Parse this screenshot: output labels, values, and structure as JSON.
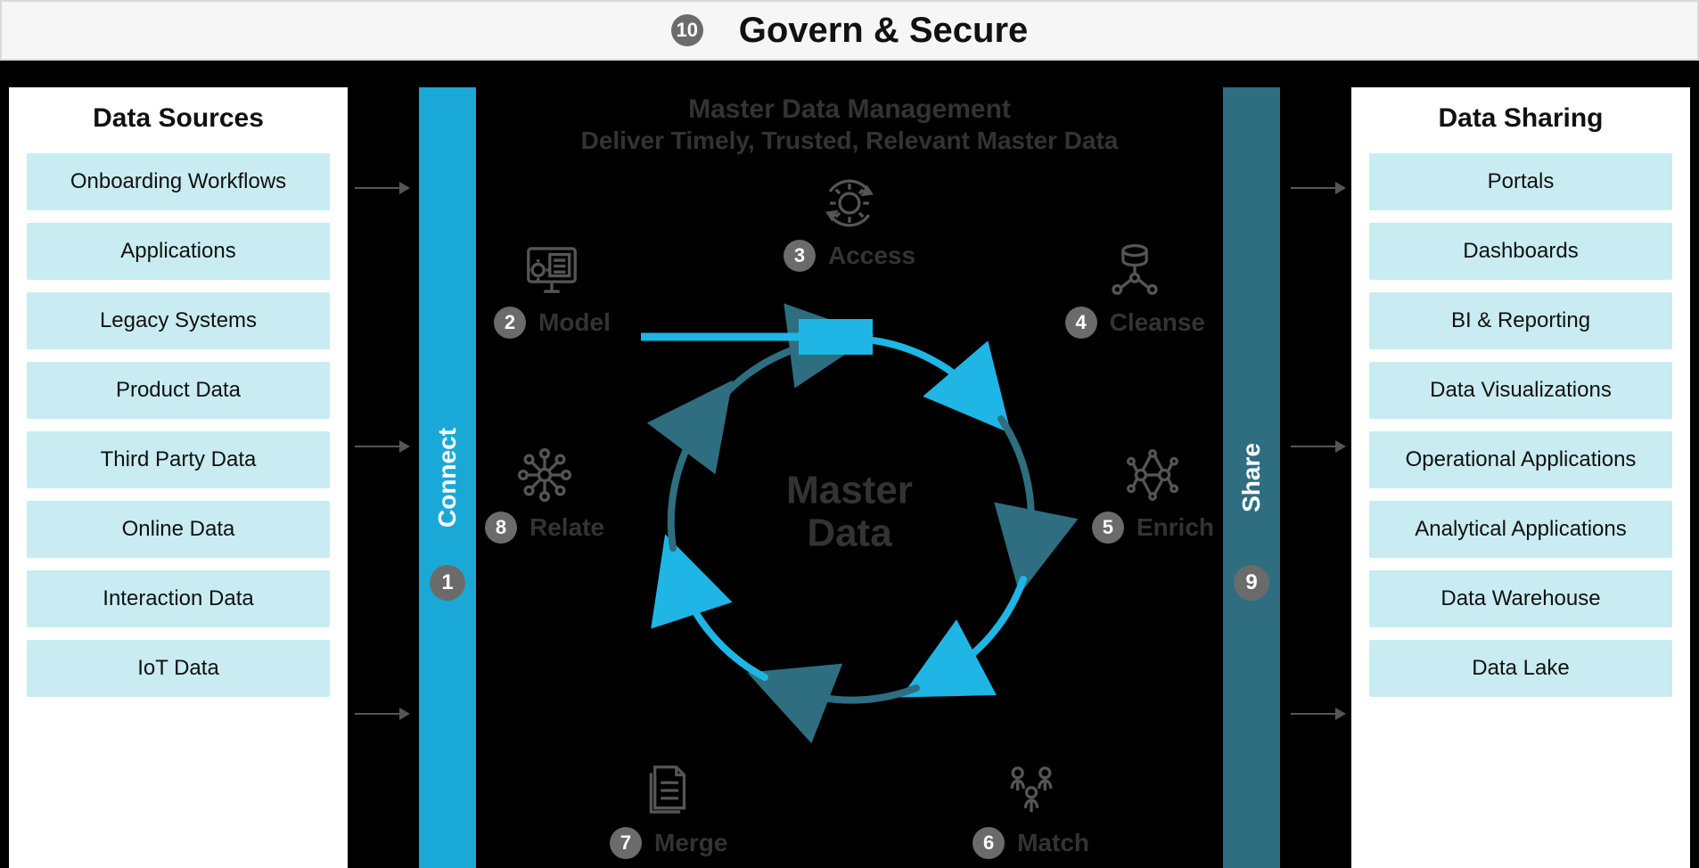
{
  "topbar": {
    "number": "10",
    "title": "Govern & Secure"
  },
  "left_panel": {
    "title": "Data Sources",
    "items": [
      "Onboarding Workflows",
      "Applications",
      "Legacy Systems",
      "Product Data",
      "Third Party Data",
      "Online Data",
      "Interaction Data",
      "IoT Data"
    ]
  },
  "right_panel": {
    "title": "Data Sharing",
    "items": [
      "Portals",
      "Dashboards",
      "BI & Reporting",
      "Data Visualizations",
      "Operational Applications",
      "Analytical Applications",
      "Data Warehouse",
      "Data Lake"
    ]
  },
  "connect_bar": {
    "number": "1",
    "label": "Connect"
  },
  "share_bar": {
    "number": "9",
    "label": "Share"
  },
  "center": {
    "title_line1": "Master Data Management",
    "title_line2": "Deliver Timely, Trusted, Relevant Master Data",
    "core_line1": "Master",
    "core_line2": "Data"
  },
  "steps": {
    "s2": {
      "n": "2",
      "label": "Model"
    },
    "s3": {
      "n": "3",
      "label": "Access"
    },
    "s4": {
      "n": "4",
      "label": "Cleanse"
    },
    "s5": {
      "n": "5",
      "label": "Enrich"
    },
    "s6": {
      "n": "6",
      "label": "Match"
    },
    "s7": {
      "n": "7",
      "label": "Merge"
    },
    "s8": {
      "n": "8",
      "label": "Relate"
    }
  }
}
